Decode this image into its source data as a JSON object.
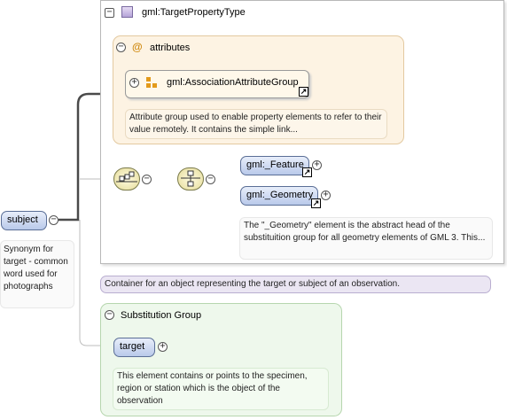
{
  "subject": {
    "label": "subject",
    "doc": "Synonym for target - common word used for photographs"
  },
  "type_box": {
    "title": "gml:TargetPropertyType",
    "doc": "Container for an object representing the target or subject of an observation."
  },
  "attributes": {
    "title": "attributes",
    "group_label": "gml:AssociationAttributeGroup",
    "doc": "Attribute group used to enable property elements to refer to their value remotely. It contains the simple link..."
  },
  "choice": {
    "feature_label": "gml:_Feature",
    "geometry_label": "gml:_Geometry",
    "geometry_doc": "The \"_Geometry\" element is the abstract head of the substituition group for all geometry elements of GML 3. This..."
  },
  "substitution": {
    "title": "Substitution Group",
    "target_label": "target",
    "target_doc": "This element contains or points to the specimen, region or station which is the object of the observation"
  },
  "icons": {
    "collapse": "−",
    "expand": "+",
    "at_sign": "@"
  },
  "colors": {
    "element_fill": "#b9c9ea",
    "attributes_bg": "#fdf3e3",
    "attributes_border": "#e3c9a0",
    "substitution_bg": "#eef8ec",
    "substitution_border": "#b6d6ae",
    "type_doc_bg": "#ebe6f3",
    "type_doc_border": "#b9aed0"
  }
}
